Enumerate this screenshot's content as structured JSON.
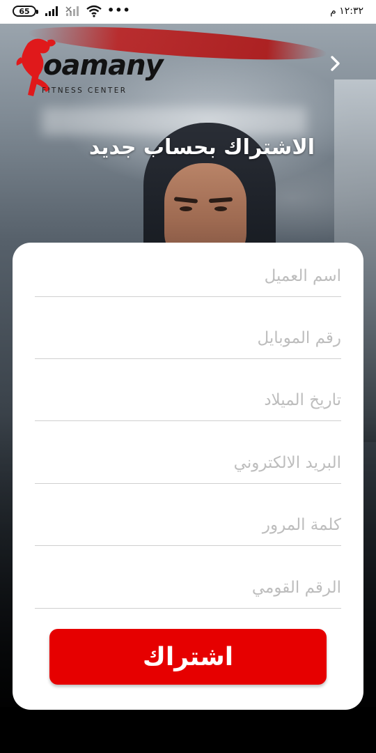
{
  "status_bar": {
    "battery": "65",
    "time": "١٢:٣٢ م"
  },
  "logo": {
    "name": "oamany",
    "tagline": "FITNESS CENTER"
  },
  "header": {
    "title": "الاشتراك بحساب جديد",
    "back_icon": "chevron-right-icon"
  },
  "form": {
    "fields": [
      {
        "placeholder": "اسم العميل",
        "value": ""
      },
      {
        "placeholder": "رقم الموبايل",
        "value": ""
      },
      {
        "placeholder": "تاريخ الميلاد",
        "value": ""
      },
      {
        "placeholder": "البريد الالكتروني",
        "value": ""
      },
      {
        "placeholder": "كلمة المرور",
        "value": ""
      },
      {
        "placeholder": "الرقم القومي",
        "value": ""
      }
    ],
    "submit_label": "اشتراك"
  },
  "colors": {
    "accent": "#e60000",
    "card": "#ffffff",
    "placeholder": "#bdbdbd"
  }
}
